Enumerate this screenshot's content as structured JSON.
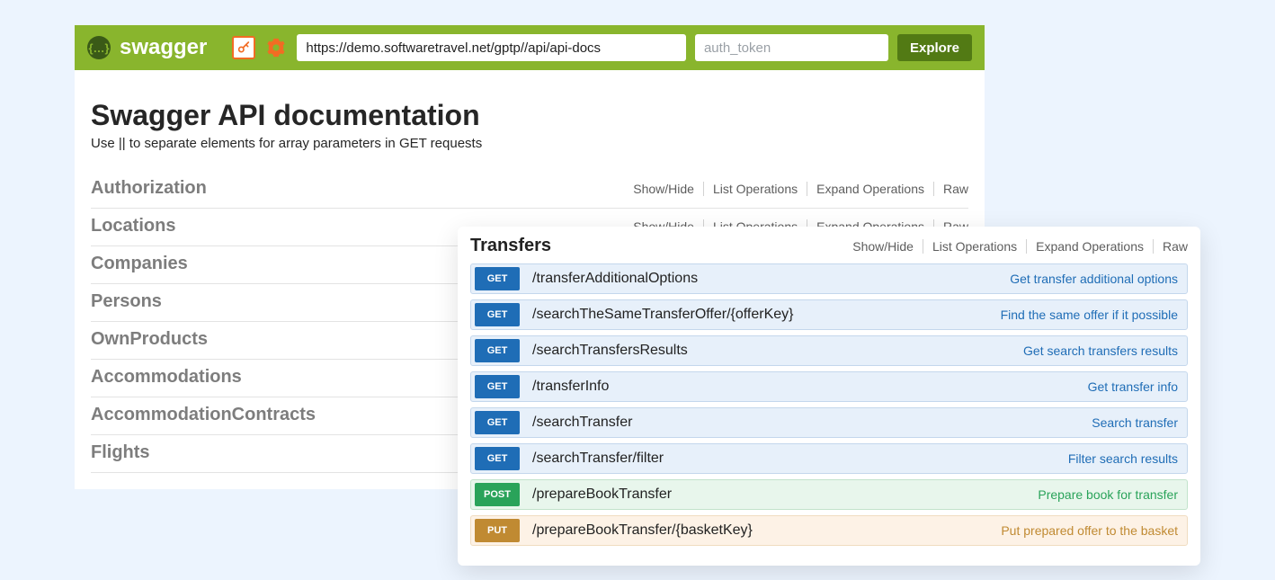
{
  "header": {
    "brand": "swagger",
    "url_value": "https://demo.softwaretravel.net/gptp//api/api-docs",
    "auth_placeholder": "auth_token",
    "explore_label": "Explore"
  },
  "page": {
    "title": "Swagger API documentation",
    "subtitle": "Use || to separate elements for array parameters in GET requests"
  },
  "action_labels": {
    "show_hide": "Show/Hide",
    "list_ops": "List Operations",
    "expand_ops": "Expand Operations",
    "raw": "Raw"
  },
  "resources": [
    {
      "name": "Authorization"
    },
    {
      "name": "Locations"
    },
    {
      "name": "Companies"
    },
    {
      "name": "Persons"
    },
    {
      "name": "OwnProducts"
    },
    {
      "name": "Accommodations"
    },
    {
      "name": "AccommodationContracts"
    },
    {
      "name": "Flights"
    }
  ],
  "transfers": {
    "title": "Transfers",
    "ops": [
      {
        "method": "GET",
        "path": "/transferAdditionalOptions",
        "desc": "Get transfer additional options"
      },
      {
        "method": "GET",
        "path": "/searchTheSameTransferOffer/{offerKey}",
        "desc": "Find the same offer if it possible"
      },
      {
        "method": "GET",
        "path": "/searchTransfersResults",
        "desc": "Get search transfers results"
      },
      {
        "method": "GET",
        "path": "/transferInfo",
        "desc": "Get transfer info"
      },
      {
        "method": "GET",
        "path": "/searchTransfer",
        "desc": "Search transfer"
      },
      {
        "method": "GET",
        "path": "/searchTransfer/filter",
        "desc": "Filter search results"
      },
      {
        "method": "POST",
        "path": "/prepareBookTransfer",
        "desc": "Prepare book for transfer"
      },
      {
        "method": "PUT",
        "path": "/prepareBookTransfer/{basketKey}",
        "desc": "Put prepared offer to the basket"
      }
    ]
  }
}
